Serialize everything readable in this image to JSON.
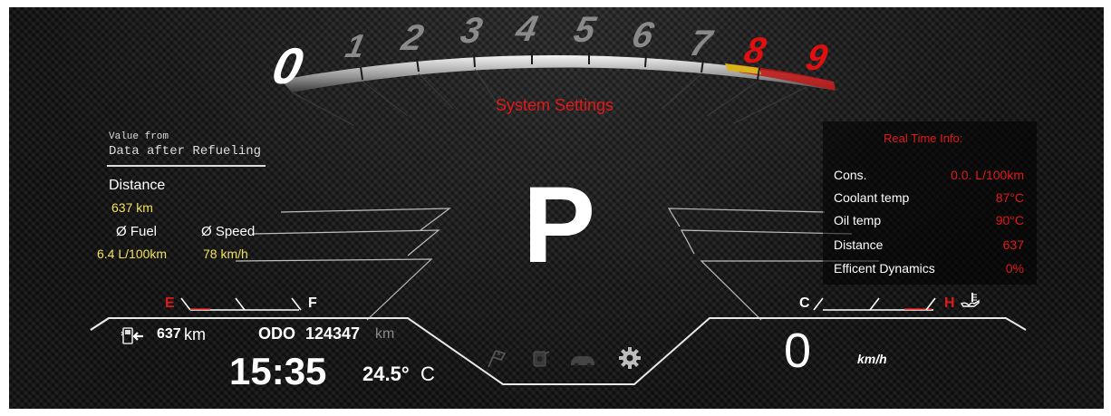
{
  "tachometer": {
    "digits": [
      "0",
      "1",
      "2",
      "3",
      "4",
      "5",
      "6",
      "7",
      "8",
      "9"
    ]
  },
  "menu_title": "System Settings",
  "left_panel": {
    "header_small": "Value from",
    "header": "Data after Refueling",
    "distance_label": "Distance",
    "distance_value": "637 km",
    "fuel_label": "Ø Fuel",
    "speed_label": "Ø Speed",
    "fuel_value": "6.4 L/100km",
    "speed_value": "78  km/h"
  },
  "gear": "P",
  "right_panel": {
    "title": "Real Time Info:",
    "rows": [
      {
        "label": "Cons.",
        "value": "0.0. L/100km"
      },
      {
        "label": "Coolant temp",
        "value": "87°C"
      },
      {
        "label": "Oil temp",
        "value": "90°C"
      },
      {
        "label": "Distance",
        "value": "637"
      },
      {
        "label": "Efficent Dynamics",
        "value": "0%"
      }
    ]
  },
  "fuel_gauge": {
    "empty_label": "E",
    "full_label": "F"
  },
  "temp_gauge": {
    "cold_label": "C",
    "hot_label": "H"
  },
  "bottom_left": {
    "range_value": "637",
    "range_unit": "km",
    "odo_label": "ODO",
    "odo_value": "124347",
    "odo_unit": "km",
    "time": "15:35",
    "outside_temp": "24.5°",
    "outside_temp_unit": "C"
  },
  "bottom_right": {
    "speed": "0",
    "speed_unit": "km/h"
  },
  "menu_icons": [
    "flag-icon",
    "fuel-can-icon",
    "car-icon",
    "gear-icon"
  ],
  "colors": {
    "accent_red": "#e01a1a",
    "value_yellow": "#f2e25a",
    "label_white": "#ffffff"
  }
}
